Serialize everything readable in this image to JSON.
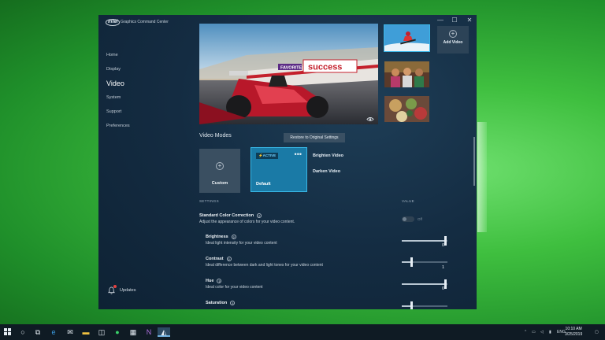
{
  "window": {
    "logo_text": "intel",
    "title": "Graphics Command Center",
    "controls": {
      "minimize": "—",
      "maximize": "☐",
      "close": "✕"
    }
  },
  "nav": {
    "items": [
      {
        "label": "Home"
      },
      {
        "label": "Display"
      },
      {
        "label": "Video"
      },
      {
        "label": "System"
      },
      {
        "label": "Support"
      },
      {
        "label": "Preferences"
      }
    ],
    "active": "Video",
    "updates_label": "Updates"
  },
  "preview": {
    "banner_text": "success",
    "sign_text": "FAVORITE"
  },
  "add_video": {
    "icon": "+",
    "label": "Add Video"
  },
  "video_modes": {
    "title": "Video Modes",
    "restore_button": "Restore to Original Settings",
    "custom": {
      "icon": "+",
      "label": "Custom"
    },
    "default": {
      "badge": "⚡ACTIVE",
      "menu": "•••",
      "label": "Default"
    },
    "options": [
      "Brighten Video",
      "Darken Video"
    ]
  },
  "settings": {
    "col_settings": "SETTINGS",
    "col_value": "VALUE",
    "standard": {
      "title": "Standard Color Correction",
      "info": "?",
      "desc": "Adjust the appearance of colors for your video content.",
      "toggle_label": "Off",
      "toggle_on": false
    },
    "sliders": [
      {
        "title": "Brightness",
        "info": "?",
        "desc": "Ideal light intensity for your video content",
        "value": "0",
        "fraction": 0.95
      },
      {
        "title": "Contrast",
        "info": "?",
        "desc": "Ideal difference between dark and light tones for your video content",
        "value": "1",
        "fraction": 0.22
      },
      {
        "title": "Hue",
        "info": "?",
        "desc": "Ideal color for your video content",
        "value": "0",
        "fraction": 0.95
      },
      {
        "title": "Saturation",
        "info": "?",
        "desc": "",
        "value": "",
        "fraction": 0.22
      }
    ]
  },
  "taskbar": {
    "tray_lang": "ENG",
    "time": "10:10 AM",
    "date": "3/25/2019"
  },
  "colors": {
    "accent": "#1a7aa6",
    "accent_border": "#39b7e6",
    "app_bg": "#142c42",
    "desktop": "#3fbf3f"
  }
}
